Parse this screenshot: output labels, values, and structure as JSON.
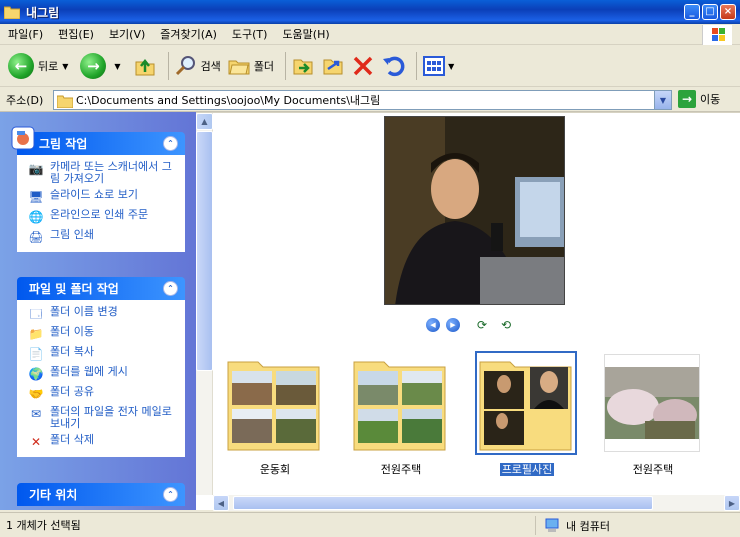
{
  "window": {
    "title": "내그림"
  },
  "menu": [
    "파일(F)",
    "편집(E)",
    "보기(V)",
    "즐겨찾기(A)",
    "도구(T)",
    "도움말(H)"
  ],
  "toolbar": {
    "back": "뒤로",
    "search": "검색",
    "folders": "폴더"
  },
  "address": {
    "label": "주소(D)",
    "path": "C:\\Documents and Settings\\oojoo\\My Documents\\내그림",
    "go": "이동"
  },
  "panels": {
    "picture_tasks": {
      "title": "그림 작업",
      "items": [
        "카메라 또는 스캐너에서 그림 가져오기",
        "슬라이드 쇼로 보기",
        "온라인으로 인쇄 주문",
        "그림 인쇄"
      ]
    },
    "file_tasks": {
      "title": "파일 및 폴더 작업",
      "items": [
        "폴더 이름 변경",
        "폴더 이동",
        "폴더 복사",
        "폴더를 웹에 게시",
        "폴더 공유",
        "폴더의 파일을 전자 메일로 보내기",
        "폴더 삭제"
      ]
    },
    "other_places": {
      "title": "기타 위치"
    }
  },
  "thumbnails": [
    {
      "label": "운동회",
      "kind": "folder",
      "selected": false
    },
    {
      "label": "전원주택",
      "kind": "folder",
      "selected": false
    },
    {
      "label": "프로필사진",
      "kind": "folder",
      "selected": true
    },
    {
      "label": "전원주택",
      "kind": "image",
      "selected": false
    }
  ],
  "status": {
    "left": "1 개체가 선택됨",
    "right": "내 컴퓨터"
  },
  "colors": {
    "accent": "#316ac5",
    "task_link": "#215dc6",
    "pane_bg": "#6f8fe0"
  }
}
